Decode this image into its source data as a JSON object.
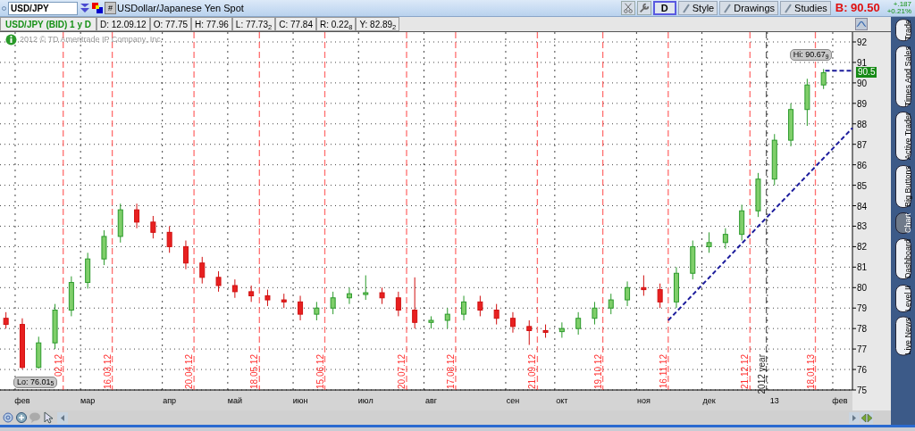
{
  "symbol_bar": {
    "symbol": "USD/JPY",
    "description": "USDollar/Japanese Yen Spot",
    "link_button": "#",
    "aggregation": "D",
    "buttons": [
      "Style",
      "Drawings",
      "Studies"
    ],
    "bid": "B: 90.50",
    "change": "+.187",
    "change_percent": "+0.21%"
  },
  "info_bar": {
    "title": "USD/JPY (BID) 1 y D",
    "fields": [
      "D: 12.09.12",
      "O: 77.75",
      "H: 77.96",
      "L: 77.73$_{2}$",
      "C: 77.84",
      "R: 0.22$_{8}$",
      "Y: 82.89$_{2}$"
    ]
  },
  "copyright": "2012 © TD Ameritrade IP Company, Inc.",
  "chart": {
    "low_label": "Lo: 76.01$_{5}$",
    "high_label": "Hi: 90.67$_{9}$",
    "last_price_label": "90.5",
    "date_markers": [
      {
        "kind": "date",
        "label": "02.12"
      },
      {
        "kind": "date",
        "label": "16.03.12"
      },
      {
        "kind": "date",
        "label": "20.04.12"
      },
      {
        "kind": "date",
        "label": "18.05.12"
      },
      {
        "kind": "date",
        "label": "15.06.12"
      },
      {
        "kind": "date",
        "label": "20.07.12"
      },
      {
        "kind": "date",
        "label": "17.08.12"
      },
      {
        "kind": "date",
        "label": "21.09.12"
      },
      {
        "kind": "date",
        "label": "19.10.12"
      },
      {
        "kind": "date",
        "label": "16.11.12"
      },
      {
        "kind": "date",
        "label": "21.12.12"
      },
      {
        "kind": "year",
        "label": "2012 year"
      },
      {
        "kind": "date",
        "label": "18.01.13"
      }
    ],
    "chart_data": {
      "type": "candlestick",
      "ylim": [
        75,
        92.48
      ],
      "grid": true,
      "categories": [
        null,
        "фев",
        null,
        null,
        null,
        "мар",
        null,
        null,
        null,
        null,
        "апр",
        null,
        null,
        null,
        "май",
        null,
        null,
        null,
        "июн",
        null,
        null,
        null,
        "июл",
        null,
        null,
        null,
        "авг",
        null,
        null,
        null,
        null,
        "сен",
        null,
        null,
        "окт",
        null,
        null,
        null,
        null,
        "ноя",
        null,
        null,
        null,
        "дек",
        null,
        null,
        null,
        "13",
        null,
        null,
        null,
        "фев"
      ],
      "ohlc": [
        [
          78.5,
          78.8,
          78.0,
          78.2
        ],
        [
          78.2,
          78.5,
          76.015,
          76.1
        ],
        [
          76.1,
          77.6,
          76.05,
          77.3
        ],
        [
          77.3,
          79.2,
          77.0,
          78.9
        ],
        [
          78.9,
          80.55,
          78.6,
          80.25
        ],
        [
          80.25,
          81.7,
          79.95,
          81.4
        ],
        [
          81.4,
          82.8,
          81.1,
          82.5
        ],
        [
          82.5,
          84.1,
          82.2,
          83.8
        ],
        [
          83.8,
          84.1,
          82.9,
          83.2
        ],
        [
          83.2,
          83.5,
          82.4,
          82.7
        ],
        [
          82.7,
          83.0,
          81.7,
          82.0
        ],
        [
          82.0,
          82.3,
          80.9,
          81.2
        ],
        [
          81.2,
          81.5,
          80.2,
          80.5
        ],
        [
          80.5,
          80.8,
          79.8,
          80.1
        ],
        [
          80.1,
          80.4,
          79.5,
          79.8
        ],
        [
          79.8,
          80.1,
          79.3,
          79.6
        ],
        [
          79.6,
          79.9,
          79.1,
          79.4
        ],
        [
          79.4,
          79.7,
          79.0,
          79.3
        ],
        [
          79.3,
          79.6,
          78.4,
          78.7
        ],
        [
          78.7,
          79.3,
          78.4,
          79.0
        ],
        [
          79.0,
          79.8,
          78.7,
          79.5
        ],
        [
          79.5,
          80.0,
          79.2,
          79.7
        ],
        [
          79.7,
          80.6,
          79.4,
          79.75
        ],
        [
          79.75,
          80.0,
          79.2,
          79.5
        ],
        [
          79.5,
          79.8,
          78.6,
          78.9
        ],
        [
          78.9,
          80.5,
          78.0,
          78.3
        ],
        [
          78.3,
          78.6,
          78.0,
          78.4
        ],
        [
          78.4,
          79.0,
          78.0,
          78.7
        ],
        [
          78.7,
          79.6,
          78.4,
          79.3
        ],
        [
          79.3,
          79.6,
          78.6,
          78.9
        ],
        [
          78.9,
          79.2,
          78.2,
          78.5
        ],
        [
          78.5,
          78.8,
          77.8,
          78.1
        ],
        [
          78.1,
          78.4,
          77.2,
          77.9
        ],
        [
          77.9,
          78.2,
          77.55,
          77.85
        ],
        [
          77.85,
          78.3,
          77.55,
          78.0
        ],
        [
          78.0,
          78.8,
          77.7,
          78.5
        ],
        [
          78.5,
          79.3,
          78.2,
          79.0
        ],
        [
          79.0,
          79.7,
          78.7,
          79.4
        ],
        [
          79.4,
          80.3,
          79.1,
          80.0
        ],
        [
          80.0,
          80.6,
          79.6,
          79.9
        ],
        [
          79.9,
          80.2,
          79.0,
          79.3
        ],
        [
          79.3,
          81.0,
          79.0,
          80.7
        ],
        [
          80.7,
          82.3,
          80.4,
          82.0
        ],
        [
          82.0,
          82.7,
          81.7,
          82.2
        ],
        [
          82.2,
          82.9,
          81.9,
          82.6
        ],
        [
          82.6,
          84.05,
          82.3,
          83.75
        ],
        [
          83.75,
          85.6,
          83.45,
          85.3
        ],
        [
          85.3,
          87.5,
          85.0,
          87.2
        ],
        [
          87.2,
          89.0,
          86.9,
          88.7
        ],
        [
          88.7,
          90.2,
          87.9,
          89.9
        ],
        [
          89.9,
          90.679,
          89.7,
          90.5
        ],
        null
      ],
      "yticks": [
        75,
        76,
        77,
        78,
        79,
        80,
        81,
        82,
        83,
        84,
        85,
        86,
        87,
        88,
        89,
        90,
        91,
        92
      ]
    }
  },
  "side_tabs": [
    {
      "label": "Trade",
      "selected": false
    },
    {
      "label": "Times And Sales",
      "selected": false
    },
    {
      "label": "Active Trader",
      "selected": false
    },
    {
      "label": "Big Buttons",
      "selected": false
    },
    {
      "label": "Chart",
      "selected": true
    },
    {
      "label": "Dashboard",
      "selected": false
    },
    {
      "label": "Level II",
      "selected": false
    },
    {
      "label": "Live News",
      "selected": false
    }
  ]
}
